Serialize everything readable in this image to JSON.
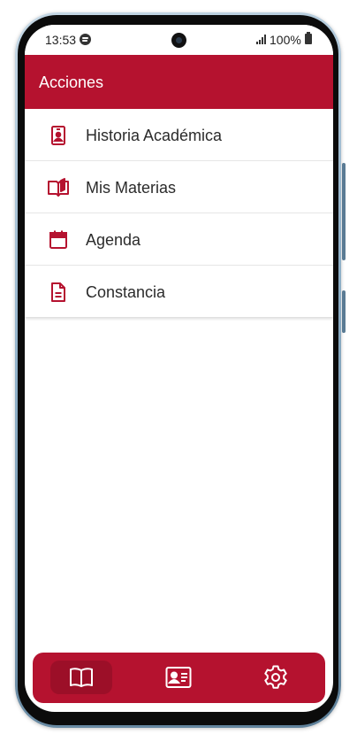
{
  "status_bar": {
    "time": "13:53",
    "battery": "100%",
    "icons": [
      "spotify-icon",
      "camera",
      "signal-icon",
      "battery-icon"
    ]
  },
  "app_bar": {
    "title": "Acciones"
  },
  "menu": {
    "items": [
      {
        "label": "Historia Académica",
        "icon": "id-badge-icon"
      },
      {
        "label": "Mis Materias",
        "icon": "open-book-icon"
      },
      {
        "label": "Agenda",
        "icon": "calendar-icon"
      },
      {
        "label": "Constancia",
        "icon": "document-icon"
      }
    ]
  },
  "bottom_nav": {
    "items": [
      {
        "icon": "book-icon",
        "active": true
      },
      {
        "icon": "id-card-icon",
        "active": false
      },
      {
        "icon": "gear-icon",
        "active": false
      }
    ]
  },
  "colors": {
    "primary": "#b5122f",
    "primary_dark": "#9c0f28",
    "text": "#2b2b2b",
    "background": "#ffffff"
  }
}
